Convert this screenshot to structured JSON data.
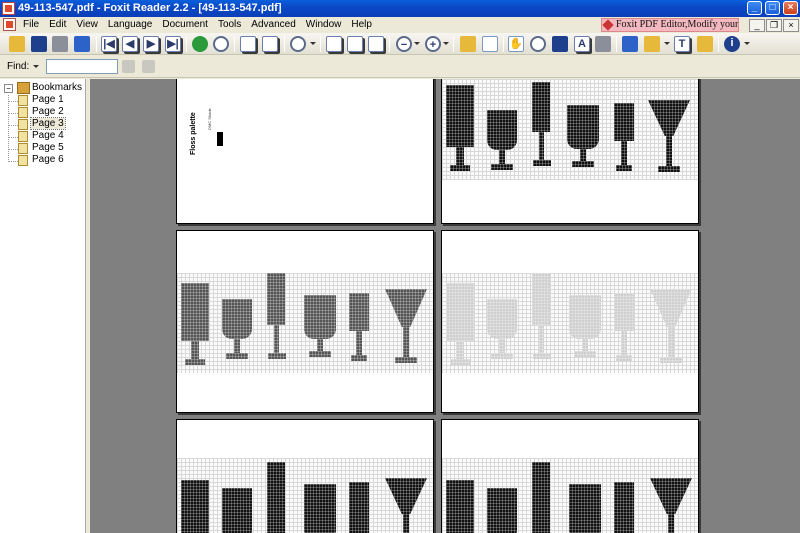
{
  "window": {
    "title": "49-113-547.pdf - Foxit Reader 2.2 - [49-113-547.pdf]",
    "controls": {
      "minimize": "_",
      "maximize": "□",
      "close": "×"
    }
  },
  "menu": {
    "items": [
      "File",
      "Edit",
      "View",
      "Language",
      "Document",
      "Tools",
      "Advanced",
      "Window",
      "Help"
    ],
    "promo": "Foxit PDF Editor,Modify your PDF!"
  },
  "findbar": {
    "label": "Find:",
    "value": ""
  },
  "bookmarks": {
    "root_label": "Bookmarks",
    "expander": "−",
    "items": [
      {
        "label": "Page 1"
      },
      {
        "label": "Page 2"
      },
      {
        "label": "Page 3"
      },
      {
        "label": "Page 4"
      },
      {
        "label": "Page 5"
      },
      {
        "label": "Page 6"
      }
    ],
    "selected": "Page 3"
  },
  "document": {
    "first_page_text": "Floss palette",
    "first_page_small_text": "DMC  Shade"
  },
  "colors": {
    "titlebar": "#0b49c6",
    "workspace": "#808080",
    "promo_bg": "#f3b8c0"
  },
  "icons": [
    "open-icon",
    "save-icon",
    "print-icon",
    "email-icon",
    "first-page-icon",
    "previous-page-icon",
    "next-page-icon",
    "last-page-icon",
    "go-back-icon",
    "go-forward-icon",
    "rotate-left-icon",
    "rotate-right-icon",
    "zoom-icon",
    "actual-size-icon",
    "fit-page-icon",
    "fit-width-icon",
    "zoom-out-icon",
    "zoom-in-icon",
    "bookmark-pane-icon",
    "page-layout-icon",
    "hand-tool-icon",
    "reflow-icon",
    "find-icon",
    "select-text-icon",
    "snapshot-icon",
    "typewriter-icon",
    "highlight-icon",
    "text-tool-icon",
    "comment-icon",
    "info-icon"
  ]
}
